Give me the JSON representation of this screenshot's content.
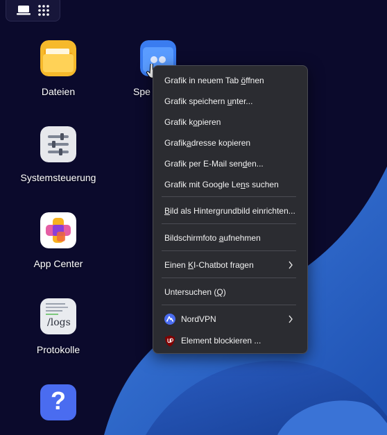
{
  "desktop_icons": [
    {
      "label": "Dateien",
      "icon": "folder-icon"
    },
    {
      "label": "Systemsteuerung",
      "icon": "sliders-icon"
    },
    {
      "label": "App Center",
      "icon": "app-center-icon"
    },
    {
      "label": "Protokolle",
      "icon": "logs-icon",
      "tile_text": "/logs"
    },
    {
      "label": "",
      "icon": "help-icon",
      "tile_text": "?"
    },
    {
      "label": "Spe",
      "icon": "storage-folder-icon"
    }
  ],
  "context_menu": {
    "items": [
      {
        "pre": "Grafik in neuem Tab ",
        "acc": "ö",
        "post": "ffnen"
      },
      {
        "pre": "Grafik speichern ",
        "acc": "u",
        "post": "nter..."
      },
      {
        "pre": "Grafik k",
        "acc": "o",
        "post": "pieren"
      },
      {
        "pre": "Grafik",
        "acc": "a",
        "post": "dresse kopieren"
      },
      {
        "pre": "Grafik per E-Mail sen",
        "acc": "d",
        "post": "en..."
      },
      {
        "pre": "Grafik mit Google Le",
        "acc": "n",
        "post": "s suchen"
      },
      {
        "pre": "",
        "acc": "B",
        "post": "ild als Hintergrundbild einrichten..."
      },
      {
        "pre": "Bildschirmfoto ",
        "acc": "a",
        "post": "ufnehmen"
      },
      {
        "pre": "Einen ",
        "acc": "K",
        "post": "I-Chatbot fragen"
      },
      {
        "pre": "Untersuchen (",
        "acc": "Q",
        "post": ")"
      },
      {
        "pre": "NordVPN",
        "acc": "",
        "post": ""
      },
      {
        "pre": "Element blockieren ...",
        "acc": "",
        "post": ""
      }
    ]
  },
  "colors": {
    "background": "#0b0a2c",
    "menu_background": "#2b2c31",
    "menu_text": "#f2f2f2",
    "wallpaper_accent": "#2f68c8"
  }
}
